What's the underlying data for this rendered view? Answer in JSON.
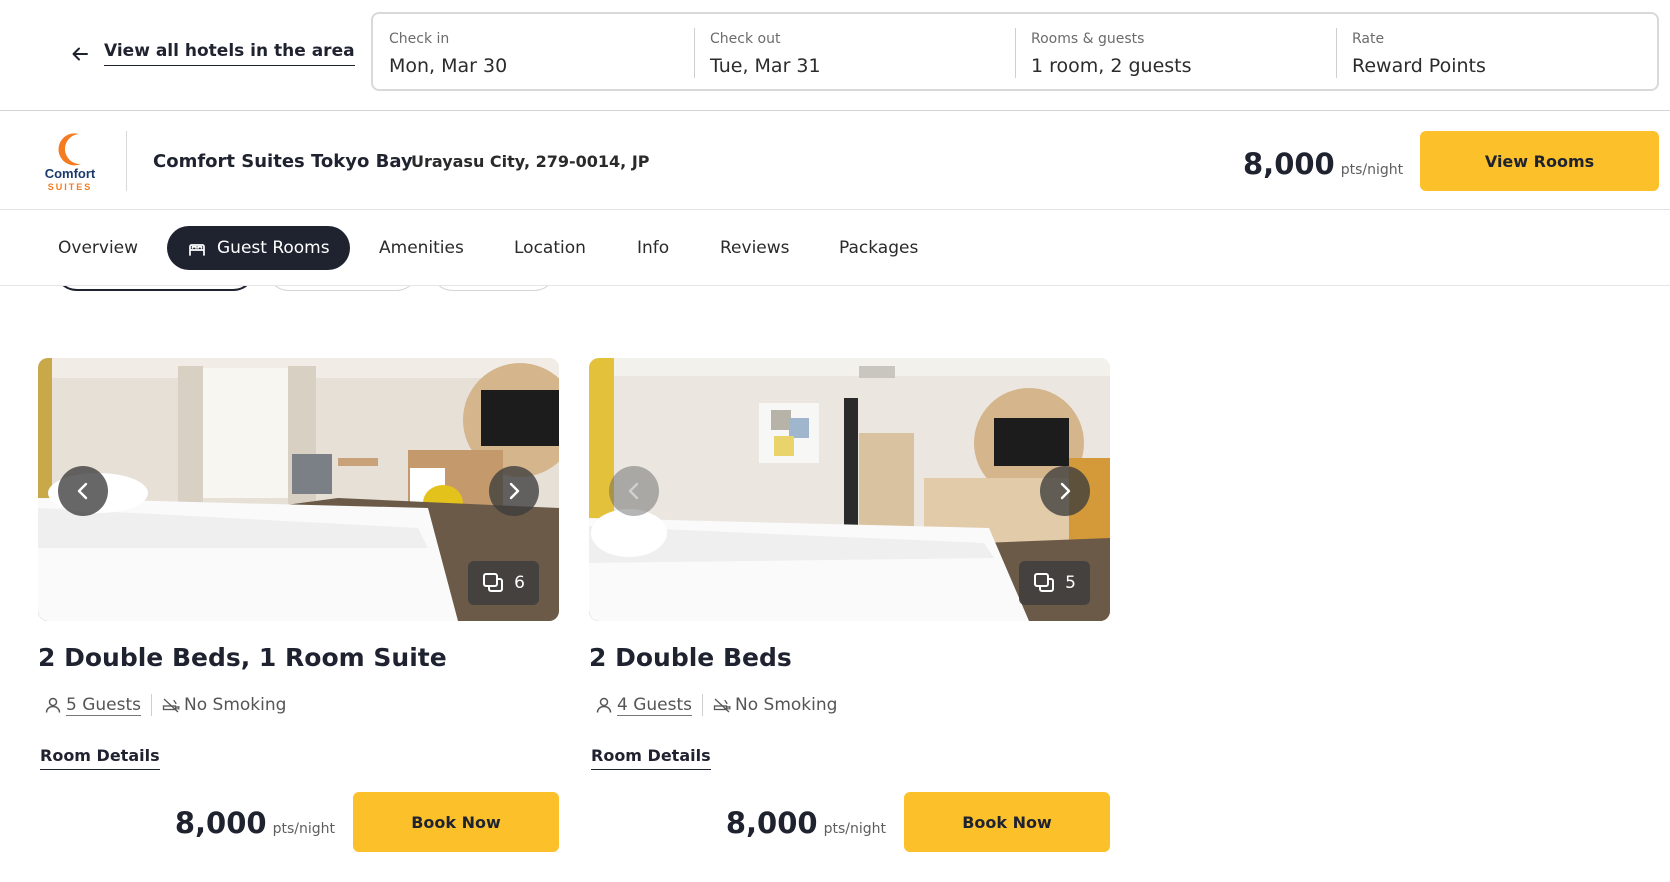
{
  "topbar": {
    "back_label": "View all hotels in the area",
    "search": [
      {
        "label": "Check in",
        "value": "Mon, Mar 30"
      },
      {
        "label": "Check out",
        "value": "Tue, Mar 31"
      },
      {
        "label": "Rooms & guests",
        "value": "1 room, 2 guests"
      },
      {
        "label": "Rate",
        "value": "Reward Points"
      }
    ]
  },
  "hotel": {
    "logo_line1": "Comfort",
    "logo_line2": "SUITES",
    "name": "Comfort Suites Tokyo Bay",
    "address": "Urayasu City, 279-0014, JP",
    "price": "8,000",
    "price_unit": "pts/night",
    "view_rooms_label": "View Rooms"
  },
  "tabs": [
    {
      "label": "Overview"
    },
    {
      "label": "Guest Rooms",
      "active": true
    },
    {
      "label": "Amenities"
    },
    {
      "label": "Location"
    },
    {
      "label": "Info"
    },
    {
      "label": "Reviews"
    },
    {
      "label": "Packages"
    }
  ],
  "rooms": [
    {
      "title": "2 Double Beds, 1 Room Suite",
      "photo_count": "6",
      "guests": "5 Guests",
      "smoking": "No Smoking",
      "details_label": "Room Details",
      "price": "8,000",
      "price_unit": "pts/night",
      "book_label": "Book Now"
    },
    {
      "title": "2 Double Beds",
      "photo_count": "5",
      "guests": "4 Guests",
      "smoking": "No Smoking",
      "details_label": "Room Details",
      "price": "8,000",
      "price_unit": "pts/night",
      "book_label": "Book Now"
    }
  ],
  "colors": {
    "accent_yellow": "#fcc12a",
    "navy": "#1f2330",
    "logo_orange": "#f47b20",
    "logo_blue": "#1b3a6b"
  }
}
